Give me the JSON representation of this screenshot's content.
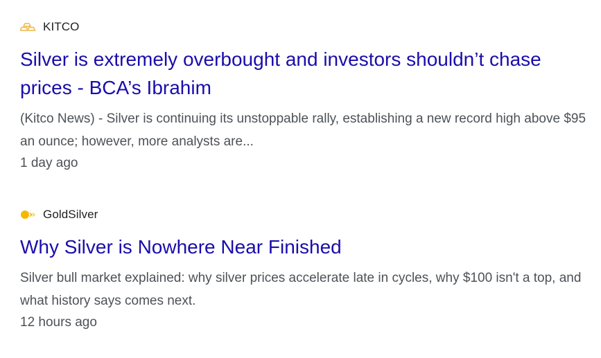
{
  "results": [
    {
      "source": {
        "name": "KITCO",
        "icon": "gold-bars-icon",
        "icon_color": "#f0c060"
      },
      "title": "Silver is extremely overbought and investors shouldn’t chase prices - BCA’s Ibrahim",
      "snippet": "(Kitco News) - Silver is continuing its unstoppable rally, establishing a new record high above $95 an ounce; however, more analysts are...",
      "time": "1 day ago"
    },
    {
      "source": {
        "name": "GoldSilver",
        "icon": "coin-icon",
        "icon_color": "#f5b800"
      },
      "title": "Why Silver is Nowhere Near Finished",
      "snippet": "Silver bull market explained: why silver prices accelerate late in cycles, why $100 isn't a top, and what history says comes next.",
      "time": "12 hours ago"
    }
  ],
  "colors": {
    "title_link": "#1a0dab",
    "snippet_text": "#4d5156",
    "source_text": "#202124"
  }
}
